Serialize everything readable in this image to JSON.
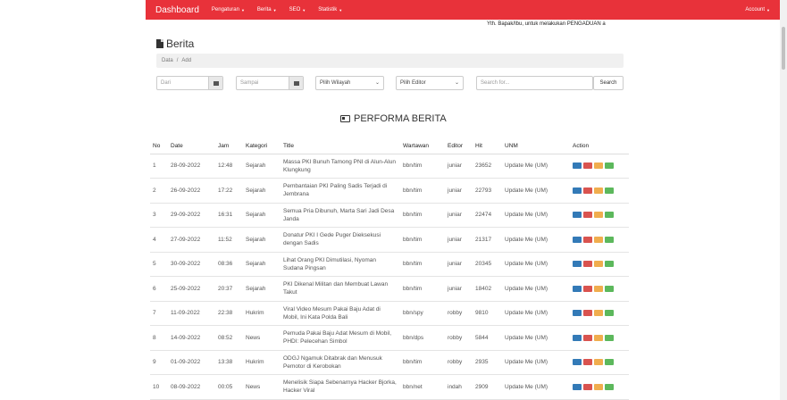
{
  "navbar": {
    "brand": "Dashboard",
    "items": [
      {
        "label": "Pengaturan"
      },
      {
        "label": "Berita"
      },
      {
        "label": "SEO"
      },
      {
        "label": "Statistik"
      }
    ],
    "account": "Account",
    "accent_color": "#e8323a"
  },
  "marquee": "Yth. Bapak/Ibu, untuk melakukan PENGADUAN a",
  "page": {
    "title": "Berita"
  },
  "breadcrumb": {
    "item1": "Data",
    "sep": "/",
    "item2": "Add"
  },
  "filters": {
    "dari_placeholder": "Dari",
    "sampai_placeholder": "Sampai",
    "wilayah": "Pilih Wilayah",
    "editor": "Pilih Editor",
    "search_placeholder": "Search for...",
    "search_button": "Search"
  },
  "section_title": "PERFORMA BERITA",
  "table": {
    "headers": [
      "No",
      "Date",
      "Jam",
      "Kategori",
      "Title",
      "Wartawan",
      "Editor",
      "Hit",
      "UNM",
      "Action"
    ],
    "rows": [
      {
        "no": "1",
        "date": "28-09-2022",
        "jam": "12:48",
        "kategori": "Sejarah",
        "title": "Massa PKI Bunuh Tamong PNI di Alun-Alun Klungkung",
        "wartawan": "bbn/tim",
        "editor": "juniar",
        "hit": "23652",
        "unm": "Update Me (UM)"
      },
      {
        "no": "2",
        "date": "26-09-2022",
        "jam": "17:22",
        "kategori": "Sejarah",
        "title": "Pembantaian PKI Paling Sadis Terjadi di Jembrana",
        "wartawan": "bbn/tim",
        "editor": "juniar",
        "hit": "22793",
        "unm": "Update Me (UM)"
      },
      {
        "no": "3",
        "date": "29-09-2022",
        "jam": "16:31",
        "kategori": "Sejarah",
        "title": "Semua Pria Dibunuh, Marta Sari Jadi Desa Janda",
        "wartawan": "bbn/tim",
        "editor": "juniar",
        "hit": "22474",
        "unm": "Update Me (UM)"
      },
      {
        "no": "4",
        "date": "27-09-2022",
        "jam": "11:52",
        "kategori": "Sejarah",
        "title": "Donatur PKI I Gede Puger Dieksekusi dengan Sadis",
        "wartawan": "bbn/tim",
        "editor": "juniar",
        "hit": "21317",
        "unm": "Update Me (UM)"
      },
      {
        "no": "5",
        "date": "30-09-2022",
        "jam": "08:36",
        "kategori": "Sejarah",
        "title": "Lihat Orang PKI Dimutilasi, Nyoman Sudana Pingsan",
        "wartawan": "bbn/tim",
        "editor": "juniar",
        "hit": "20345",
        "unm": "Update Me (UM)"
      },
      {
        "no": "6",
        "date": "25-09-2022",
        "jam": "20:37",
        "kategori": "Sejarah",
        "title": "PKI Dikenal Militan dan Membuat Lawan Takut",
        "wartawan": "bbn/tim",
        "editor": "juniar",
        "hit": "18402",
        "unm": "Update Me (UM)"
      },
      {
        "no": "7",
        "date": "11-09-2022",
        "jam": "22:38",
        "kategori": "Hukrim",
        "title": "Viral Video Mesum Pakai Baju Adat di Mobil, Ini Kata Polda Bali",
        "wartawan": "bbn/spy",
        "editor": "robby",
        "hit": "9810",
        "unm": "Update Me (UM)"
      },
      {
        "no": "8",
        "date": "14-09-2022",
        "jam": "08:52",
        "kategori": "News",
        "title": "Pemuda Pakai Baju Adat Mesum di Mobil, PHDI: Pelecehan Simbol",
        "wartawan": "bbn/dps",
        "editor": "robby",
        "hit": "5844",
        "unm": "Update Me (UM)"
      },
      {
        "no": "9",
        "date": "01-09-2022",
        "jam": "13:38",
        "kategori": "Hukrim",
        "title": "ODGJ Ngamuk Ditabrak dan Menusuk Pemotor di Kerobokan",
        "wartawan": "bbn/tim",
        "editor": "robby",
        "hit": "2935",
        "unm": "Update Me (UM)"
      },
      {
        "no": "10",
        "date": "08-09-2022",
        "jam": "00:05",
        "kategori": "News",
        "title": "Menelisik Siapa Sebenarnya Hacker Bjorka, Hacker Viral",
        "wartawan": "bbn/net",
        "editor": "indah",
        "hit": "2909",
        "unm": "Update Me (UM)"
      }
    ]
  }
}
